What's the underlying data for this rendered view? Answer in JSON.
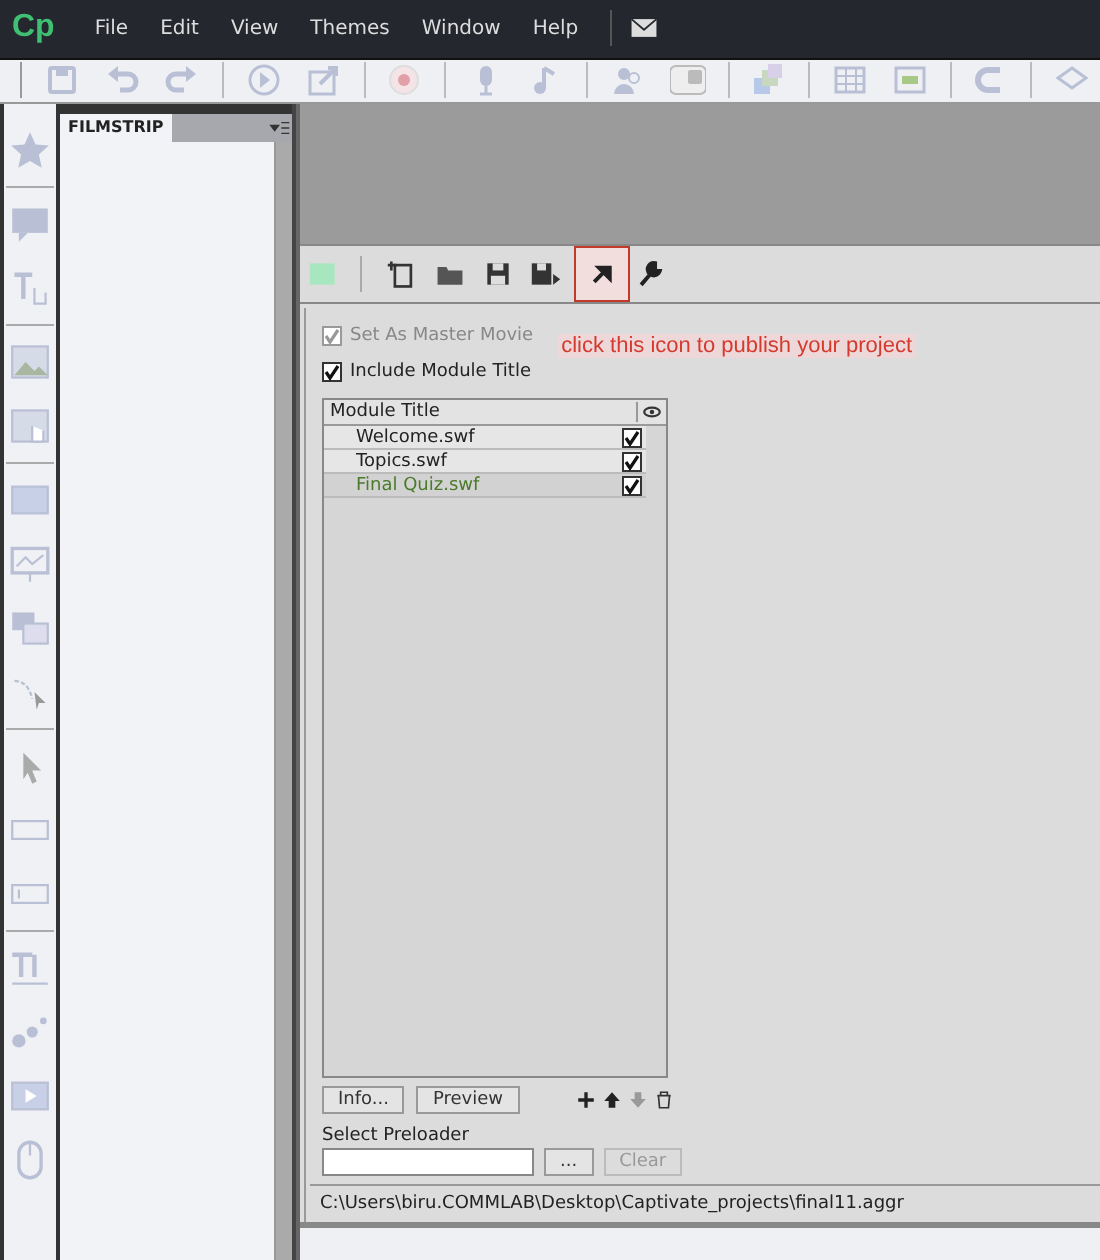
{
  "menu_bar": {
    "logo": "Cp",
    "items": [
      "File",
      "Edit",
      "View",
      "Themes",
      "Window",
      "Help"
    ]
  },
  "filmstrip": {
    "tab": "FILMSTRIP"
  },
  "aggregator": {
    "options": [
      {
        "label": "Set As Master Movie",
        "checked": true,
        "disabled": true
      },
      {
        "label": "Include Module Title",
        "checked": true,
        "disabled": false
      }
    ],
    "annotation": "click this icon to publish your project",
    "table": {
      "columns": [
        "Module Title"
      ],
      "rows": [
        {
          "name": "Welcome.swf",
          "checked": true,
          "selected": false
        },
        {
          "name": "Topics.swf",
          "checked": true,
          "selected": false
        },
        {
          "name": "Final Quiz.swf",
          "checked": true,
          "selected": true
        }
      ]
    },
    "buttons": [
      {
        "label": "Info...",
        "disabled": false
      },
      {
        "label": "Preview",
        "disabled": false
      }
    ],
    "preloader": {
      "label": "Select Preloader",
      "browse": "...",
      "clear": {
        "label": "Clear",
        "disabled": true
      }
    },
    "path": "C:\\Users\\biru.COMMLAB\\Desktop\\Captivate_projects\\final11.aggr"
  }
}
